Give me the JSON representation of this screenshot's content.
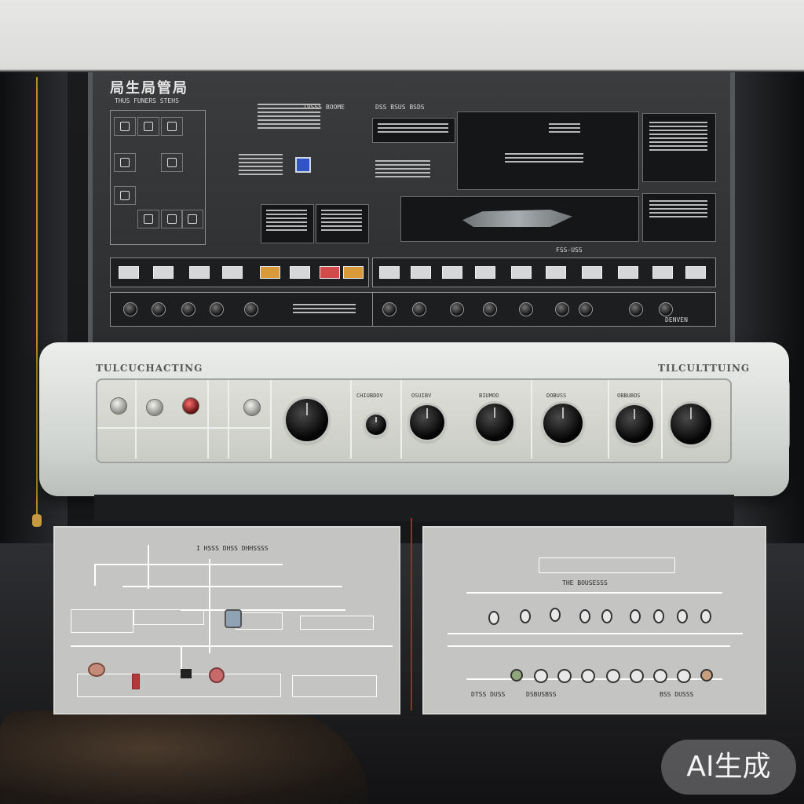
{
  "monitor": {
    "title": "局生局管局",
    "labels": [
      "THUS FUNERS STEHS",
      "TVSSS BOOME",
      "DSS BSUS BSDS",
      "FSS-USS",
      "DENVEN"
    ]
  },
  "unit": {
    "brand_left": "TULCUCHACTING",
    "brand_right": "TILCULTTUING",
    "knob_labels": [
      "CHIUBDOV",
      "OSUIBV",
      "BIUMOO",
      "DOBUSS",
      "OBBUBOS"
    ]
  },
  "left_screen": {
    "title": "I HSSS DHSS   DHHSSSS"
  },
  "right_screen": {
    "title": "THE BOUSESSS",
    "footer_labels": [
      "DTSS DUSS",
      "DSBUSBSS",
      "BSS DUSSS"
    ]
  },
  "badge": {
    "text": "AI生成"
  },
  "colors": {
    "accent_blue": "#2e55c2",
    "indicator_red": "#d14b4b",
    "indicator_orange": "#d99a3a",
    "cable_gold": "#b8872c"
  }
}
